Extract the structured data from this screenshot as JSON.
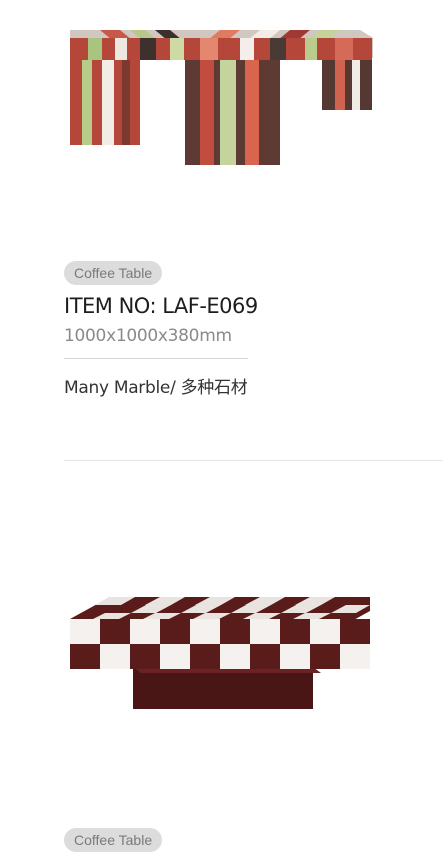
{
  "products": [
    {
      "category": "Coffee Table",
      "item_no": "ITEM NO:  LAF-E069",
      "dimensions": "1000x1000x380mm",
      "material": "Many Marble/ 多种石材",
      "image_icon": "striped-multi-marble-coffee-table"
    },
    {
      "category": "Coffee Table",
      "image_icon": "checkerboard-marble-coffee-table"
    }
  ]
}
